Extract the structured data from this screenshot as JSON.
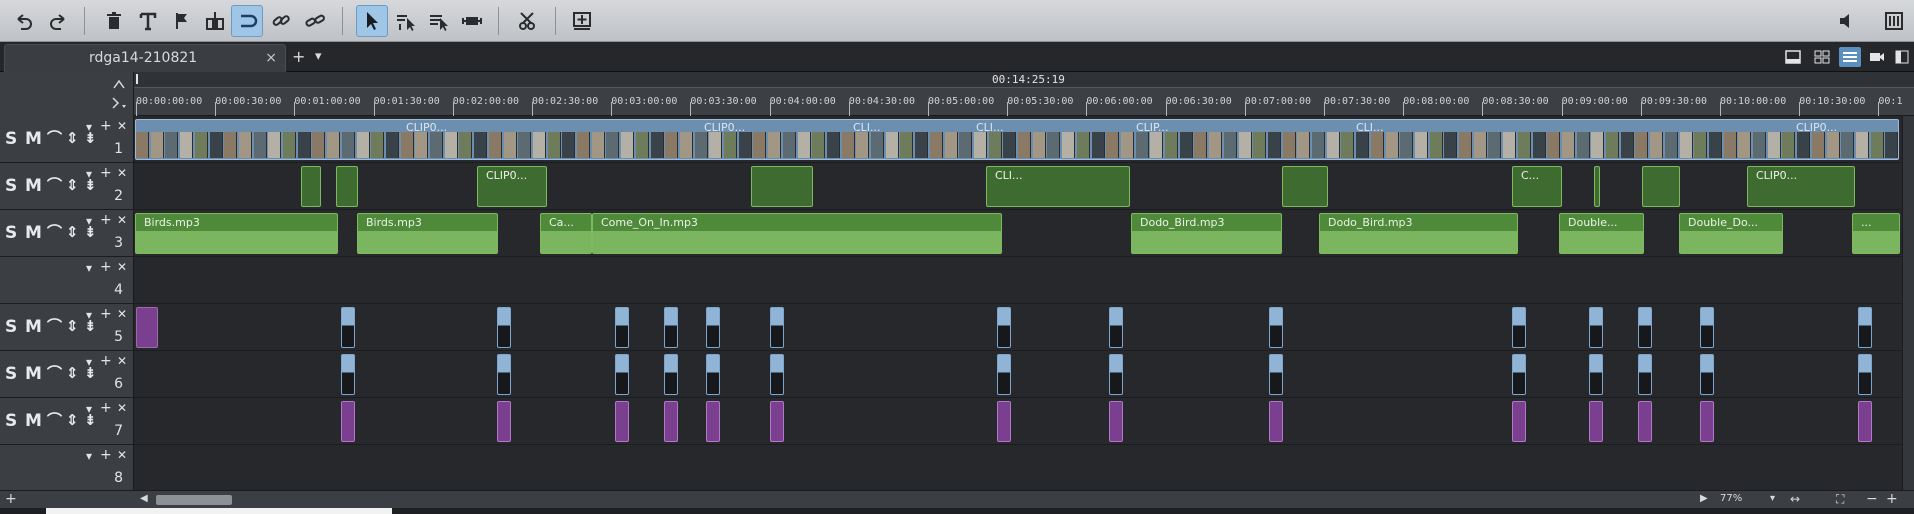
{
  "toolbar": {
    "buttons": [
      {
        "icon": "undo-icon"
      },
      {
        "icon": "redo-icon"
      },
      {
        "icon": "delete-icon"
      },
      {
        "icon": "text-icon"
      },
      {
        "icon": "marker-icon"
      },
      {
        "icon": "split-icon"
      },
      {
        "icon": "loop-icon"
      },
      {
        "icon": "link-icon"
      },
      {
        "icon": "unlink-icon"
      },
      {
        "icon": "pointer-icon"
      },
      {
        "icon": "pointer-select-icon"
      },
      {
        "icon": "pointer-multi-icon"
      },
      {
        "icon": "stretch-icon"
      },
      {
        "icon": "cut-icon"
      },
      {
        "icon": "insert-icon"
      }
    ],
    "volume_icon": "volume-icon",
    "mixer_icon": "mixer-icon"
  },
  "tabs": {
    "project_title": "rdga14-210821",
    "close_glyph": "×",
    "add_glyph": "+",
    "menu_glyph": "▾"
  },
  "ruler": {
    "position": "00:14:25:19",
    "labels": [
      "00:00:00:00",
      "00:00:30:00",
      "00:01:00:00",
      "00:01:30:00",
      "00:02:00:00",
      "00:02:30:00",
      "00:03:00:00",
      "00:03:30:00",
      "00:04:00:00",
      "00:04:30:00",
      "00:05:00:00",
      "00:05:30:00",
      "00:06:00:00",
      "00:06:30:00",
      "00:07:00:00",
      "00:07:30:00",
      "00:08:00:00",
      "00:08:30:00",
      "00:09:00:00",
      "00:09:30:00",
      "00:10:00:00",
      "00:10:30:00",
      "00:1"
    ]
  },
  "track_controls": {
    "solo": "S",
    "mute": "M",
    "lock": "⌒",
    "expand": "⇕",
    "auto": "⇟"
  },
  "tracks": [
    {
      "number": "1",
      "type": "video"
    },
    {
      "number": "2",
      "type": "video"
    },
    {
      "number": "3",
      "type": "audio"
    },
    {
      "number": "4",
      "type": "empty"
    },
    {
      "number": "5",
      "type": "fx"
    },
    {
      "number": "6",
      "type": "fx"
    },
    {
      "number": "7",
      "type": "fx"
    },
    {
      "number": "8",
      "type": "empty"
    }
  ],
  "track1_labels": [
    "CLIP0...",
    "CLIP0...",
    "CLI...",
    "CLI...",
    "CLIP...",
    "CLI...",
    "CLIP0..."
  ],
  "track2_labels": [
    "CLIP0...",
    "CLI...",
    "C...",
    "CLIP0..."
  ],
  "audio_clips": [
    "Birds.mp3",
    "Birds.mp3",
    "Ca...",
    "Come_On_In.mp3",
    "Dodo_Bird.mp3",
    "Dodo_Bird.mp3",
    "Double...",
    "Double_Do...",
    "..."
  ],
  "scroll": {
    "zoom": "77%"
  },
  "colors": {
    "accent": "#9fc6e6",
    "video_clip": "#6c8fb0",
    "audio_clip": "#4f8a3a",
    "marker_purple": "#7a3f8f"
  }
}
